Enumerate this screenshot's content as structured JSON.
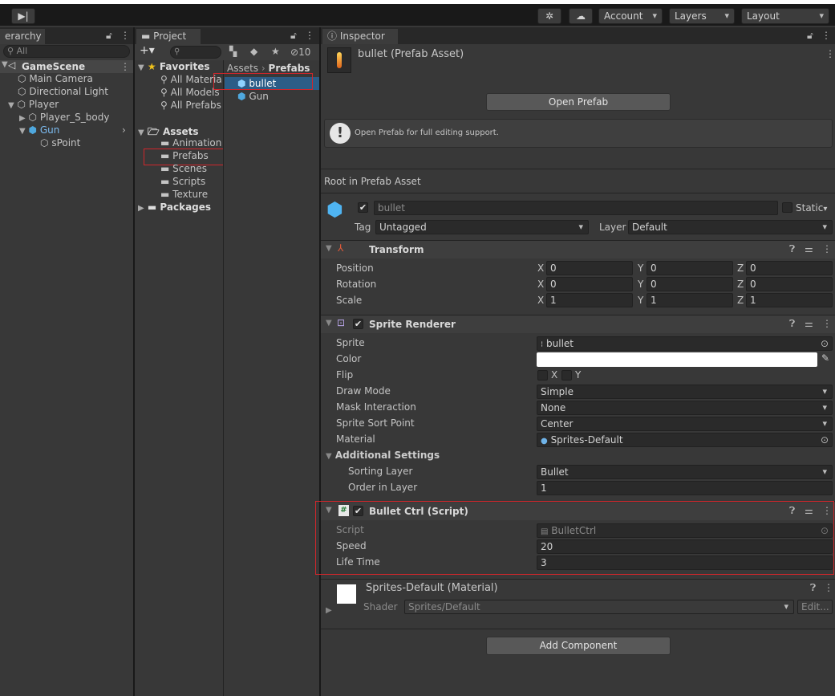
{
  "toolbar": {
    "account": "Account",
    "layers": "Layers",
    "layout": "Layout"
  },
  "hierarchy": {
    "tab": "erarchy",
    "search_placeholder": "All",
    "scene": "GameScene",
    "items": [
      "Main Camera",
      "Directional Light",
      "Player",
      "Player_S_body",
      "Gun",
      "sPoint"
    ]
  },
  "project": {
    "tab": "Project",
    "hidden_count": "10",
    "favorites_label": "Favorites",
    "favorites": [
      "All Materia",
      "All Models",
      "All Prefabs"
    ],
    "assets_label": "Assets",
    "folders": [
      "Animation",
      "Prefabs",
      "Scenes",
      "Scripts",
      "Texture"
    ],
    "packages_label": "Packages",
    "breadcrumb": [
      "Assets",
      "Prefabs"
    ],
    "files": [
      "bullet",
      "Gun"
    ]
  },
  "inspector": {
    "tab": "Inspector",
    "asset_title": "bullet (Prefab Asset)",
    "open_prefab": "Open Prefab",
    "info_text": "Open Prefab for full editing support.",
    "root_label": "Root in Prefab Asset",
    "object_name": "bullet",
    "static_label": "Static",
    "tag_label": "Tag",
    "tag_value": "Untagged",
    "layer_label": "Layer",
    "layer_value": "Default",
    "transform": {
      "title": "Transform",
      "rows": [
        {
          "label": "Position",
          "x": "0",
          "y": "0",
          "z": "0"
        },
        {
          "label": "Rotation",
          "x": "0",
          "y": "0",
          "z": "0"
        },
        {
          "label": "Scale",
          "x": "1",
          "y": "1",
          "z": "1"
        }
      ],
      "axis": [
        "X",
        "Y",
        "Z"
      ]
    },
    "sprite_renderer": {
      "title": "Sprite Renderer",
      "sprite_label": "Sprite",
      "sprite_value": "bullet",
      "color_label": "Color",
      "color_value": "#ffffff",
      "flip_label": "Flip",
      "flip_x": "X",
      "flip_y": "Y",
      "draw_mode_label": "Draw Mode",
      "draw_mode_value": "Simple",
      "mask_label": "Mask Interaction",
      "mask_value": "None",
      "sort_point_label": "Sprite Sort Point",
      "sort_point_value": "Center",
      "material_label": "Material",
      "material_value": "Sprites-Default",
      "additional_label": "Additional Settings",
      "sorting_layer_label": "Sorting Layer",
      "sorting_layer_value": "Bullet",
      "order_label": "Order in Layer",
      "order_value": "1"
    },
    "bullet_ctrl": {
      "title": "Bullet Ctrl (Script)",
      "script_label": "Script",
      "script_value": "BulletCtrl",
      "speed_label": "Speed",
      "speed_value": "20",
      "life_label": "Life Time",
      "life_value": "3"
    },
    "material": {
      "title": "Sprites-Default (Material)",
      "shader_label": "Shader",
      "shader_value": "Sprites/Default",
      "edit_label": "Edit..."
    },
    "add_component": "Add Component"
  }
}
